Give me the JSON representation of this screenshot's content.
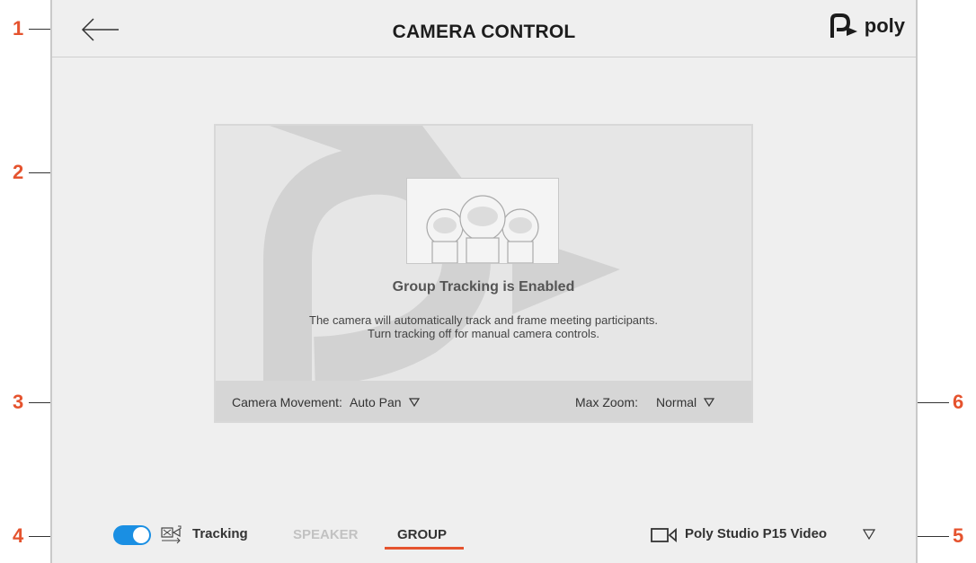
{
  "header": {
    "title": "CAMERA CONTROL",
    "logo_text": "poly",
    "back_icon": "arrow-left-icon"
  },
  "preview": {
    "status_title": "Group Tracking is Enabled",
    "status_line1": "The camera will automatically track and frame meeting participants.",
    "status_line2": "Turn tracking off for manual camera controls.",
    "camera_movement_label": "Camera Movement:",
    "camera_movement_value": "Auto Pan",
    "max_zoom_label": "Max Zoom:",
    "max_zoom_value": "Normal"
  },
  "bottom": {
    "tracking_label": "Tracking",
    "tracking_on": true,
    "tab_speaker": "SPEAKER",
    "tab_group": "GROUP",
    "active_tab": "GROUP",
    "camera_name": "Poly Studio P15 Video"
  },
  "callouts": [
    "1",
    "2",
    "3",
    "4",
    "5",
    "6"
  ],
  "colors": {
    "accent": "#e5532e",
    "toggle": "#1a8fe3",
    "background": "#efefef"
  }
}
